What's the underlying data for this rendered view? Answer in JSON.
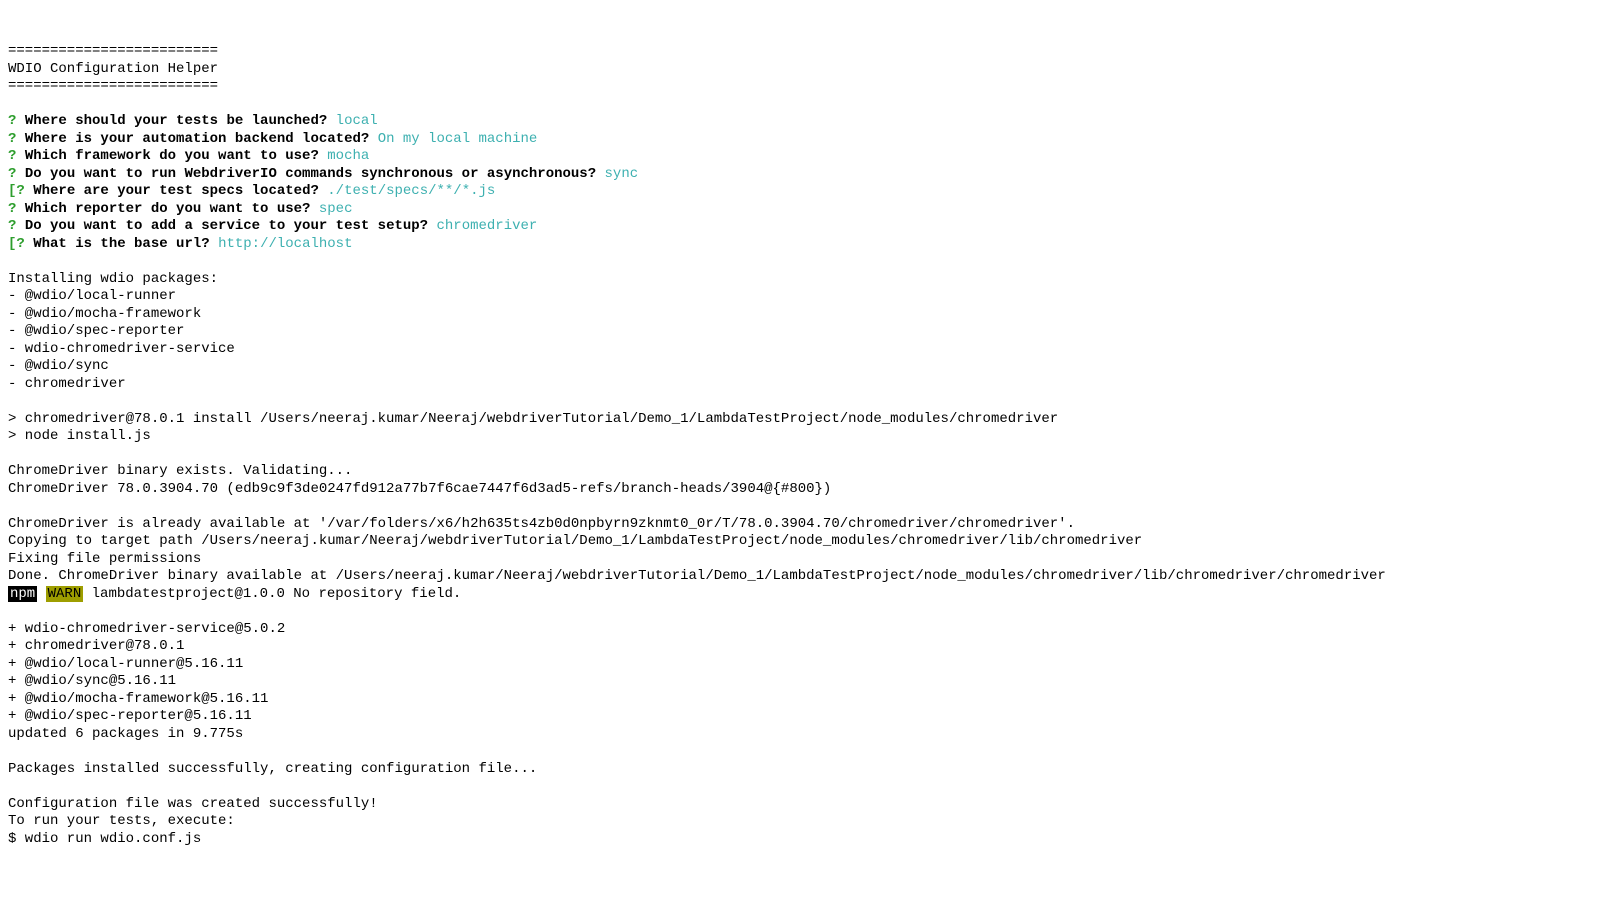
{
  "header": {
    "separator": "=========================",
    "title": "WDIO Configuration Helper"
  },
  "questions": [
    {
      "prefix": "?",
      "q": "Where should your tests be launched?",
      "a": "local"
    },
    {
      "prefix": "?",
      "q": "Where is your automation backend located?",
      "a": "On my local machine"
    },
    {
      "prefix": "?",
      "q": "Which framework do you want to use?",
      "a": "mocha"
    },
    {
      "prefix": "?",
      "q": "Do you want to run WebdriverIO commands synchronous or asynchronous?",
      "a": "sync"
    },
    {
      "prefix": "[?",
      "q": "Where are your test specs located?",
      "a": "./test/specs/**/*.js"
    },
    {
      "prefix": "?",
      "q": "Which reporter do you want to use?",
      "a": "spec"
    },
    {
      "prefix": "?",
      "q": "Do you want to add a service to your test setup?",
      "a": "chromedriver"
    },
    {
      "prefix": "[?",
      "q": "What is the base url?",
      "a": "http://localhost"
    }
  ],
  "install_header": "Installing wdio packages:",
  "install_packages": [
    "- @wdio/local-runner",
    "- @wdio/mocha-framework",
    "- @wdio/spec-reporter",
    "- wdio-chromedriver-service",
    "- @wdio/sync",
    "- chromedriver"
  ],
  "commands": [
    "> chromedriver@78.0.1 install /Users/neeraj.kumar/Neeraj/webdriverTutorial/Demo_1/LambdaTestProject/node_modules/chromedriver",
    "> node install.js"
  ],
  "chrome_lines": [
    "ChromeDriver binary exists. Validating...",
    "ChromeDriver 78.0.3904.70 (edb9c9f3de0247fd912a77b7f6cae7447f6d3ad5-refs/branch-heads/3904@{#800})"
  ],
  "chrome_lines2": [
    "ChromeDriver is already available at '/var/folders/x6/h2h635ts4zb0d0npbyrn9zknmt0_0r/T/78.0.3904.70/chromedriver/chromedriver'.",
    "Copying to target path /Users/neeraj.kumar/Neeraj/webdriverTutorial/Demo_1/LambdaTestProject/node_modules/chromedriver/lib/chromedriver",
    "Fixing file permissions",
    "Done. ChromeDriver binary available at /Users/neeraj.kumar/Neeraj/webdriverTutorial/Demo_1/LambdaTestProject/node_modules/chromedriver/lib/chromedriver/chromedriver"
  ],
  "npm_warn": {
    "npm": "npm",
    "warn": "WARN",
    "msg": " lambdatestproject@1.0.0 No repository field."
  },
  "added_packages": [
    "+ wdio-chromedriver-service@5.0.2",
    "+ chromedriver@78.0.1",
    "+ @wdio/local-runner@5.16.11",
    "+ @wdio/sync@5.16.11",
    "+ @wdio/mocha-framework@5.16.11",
    "+ @wdio/spec-reporter@5.16.11"
  ],
  "updated_line": "updated 6 packages in 9.775s",
  "success_lines": [
    "Packages installed successfully, creating configuration file...",
    "",
    "Configuration file was created successfully!",
    "To run your tests, execute:",
    "$ wdio run wdio.conf.js"
  ]
}
